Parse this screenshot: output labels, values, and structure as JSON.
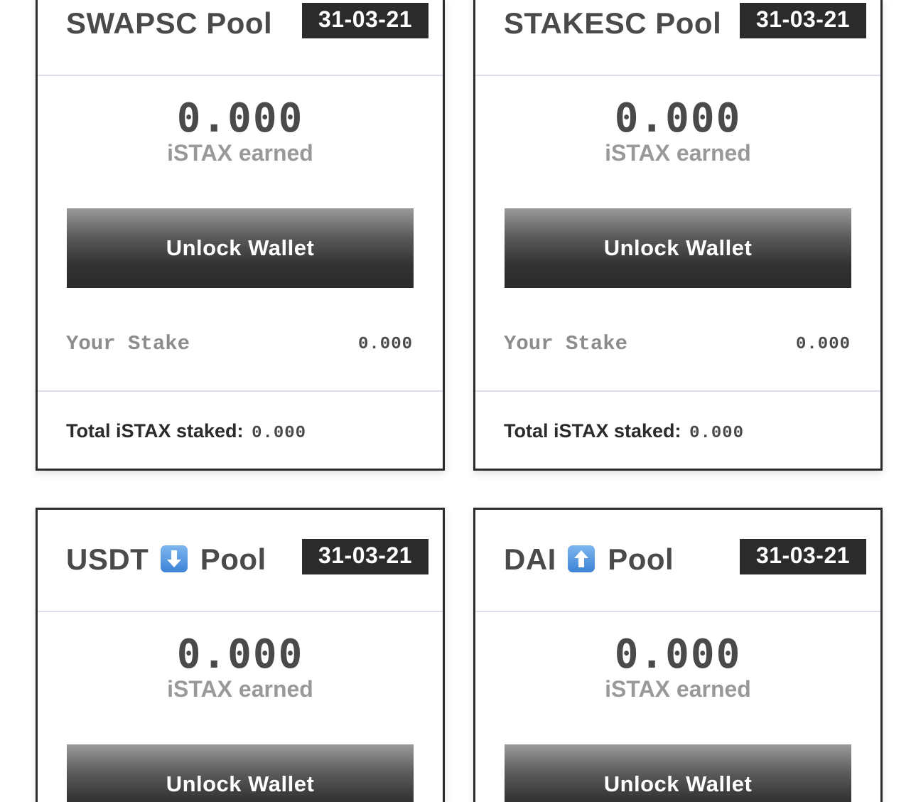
{
  "pools": [
    {
      "title_prefix": "SWAPSC",
      "title_suffix": "Pool",
      "icon": "",
      "date": "31-03-21",
      "earned_value": "0.000",
      "earned_label": "iSTAX earned",
      "button_label": "Unlock Wallet",
      "stake_label": "Your Stake",
      "stake_value": "0.000",
      "total_label": "Total iSTAX staked:",
      "total_value": "0.000"
    },
    {
      "title_prefix": "STAKESC",
      "title_suffix": "Pool",
      "icon": "",
      "date": "31-03-21",
      "earned_value": "0.000",
      "earned_label": "iSTAX earned",
      "button_label": "Unlock Wallet",
      "stake_label": "Your Stake",
      "stake_value": "0.000",
      "total_label": "Total iSTAX staked:",
      "total_value": "0.000"
    },
    {
      "title_prefix": "USDT",
      "title_suffix": "Pool",
      "icon": "down-arrow-icon",
      "date": "31-03-21",
      "earned_value": "0.000",
      "earned_label": "iSTAX earned",
      "button_label": "Unlock Wallet"
    },
    {
      "title_prefix": "DAI",
      "title_suffix": "Pool",
      "icon": "up-arrow-icon",
      "date": "31-03-21",
      "earned_value": "0.000",
      "earned_label": "iSTAX earned",
      "button_label": "Unlock Wallet"
    }
  ],
  "colors": {
    "badge_bg": "#2b2b2b",
    "title_text": "#4a4a4a",
    "muted_text": "#999999",
    "card_border": "#2b2b2b",
    "icon_blue": "#3b83d6"
  }
}
